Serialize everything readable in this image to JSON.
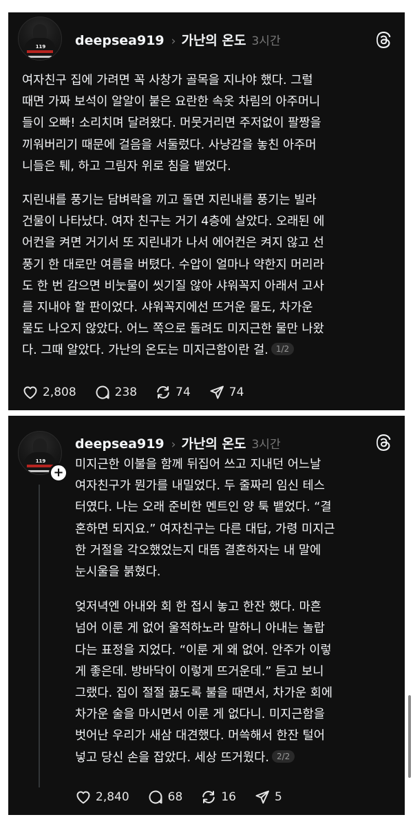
{
  "posts": [
    {
      "username": "deepsea919",
      "topic": "가난의 온도",
      "time": "3시간",
      "paragraphs": [
        [
          "여자친구 집에 가려면 꼭 사창가 골목을 지나야 했다. 그럴",
          "때면 가짜 보석이 알알이 붙은 요란한 속옷 차림의 아주머니",
          "들이 오빠! 소리치며 달려왔다. 머뭇거리면 주저없이 팔짱을",
          "끼워버리기 때문에 걸음을 서둘렀다. 사냥감을 놓친 아주머",
          "니들은 퉤, 하고 그림자 위로 침을 뱉었다."
        ],
        [
          "지린내를 풍기는 담벼락을 끼고 돌면 지린내를 풍기는 빌라",
          "건물이 나타났다. 여자 친구는 거기 4층에 살았다. 오래된 에",
          "어컨을 켜면 거기서 또 지린내가 나서 에어컨은 켜지 않고 선",
          "풍기 한 대로만 여름을 버텼다. 수압이 얼마나 약한지 머리라",
          "도 한 번 감으면 비눗물이 씻기질 않아 샤워꼭지 아래서 고사",
          "를 지내야 할 판이었다. 샤워꼭지에선 뜨거운 물도, 차가운",
          "물도 나오지 않았다. 어느 쪽으로 돌려도 미지근한 물만 나왔",
          "다. 그때 알았다. 가난의 온도는 미지근함이란 걸."
        ]
      ],
      "page": "1/2",
      "likes": "2,808",
      "comments": "238",
      "reposts": "74",
      "shares": "74"
    },
    {
      "username": "deepsea919",
      "topic": "가난의 온도",
      "time": "3시간",
      "paragraphs": [
        [
          "미지근한 이불을 함께 뒤집어 쓰고 지내던 어느날",
          "여자친구가 뭔가를 내밀었다. 두 줄짜리 임신 테스",
          "터였다. 나는 오래 준비한 멘트인 양 툭 뱉었다. “결",
          "혼하면 되지요.” 여자친구는 다른 대답, 가령 미지근",
          "한 거절을 각오했었는지 대뜸 결혼하자는 내 말에",
          "눈시울을 붉혔다."
        ],
        [
          "엊저녁엔 아내와 회 한 접시 놓고 한잔 했다. 마흔",
          "넘어 이룬 게 없어 울적하노라 말하니 아내는 놀랍",
          "다는 표정을 지었다. “이룬 게 왜 없어. 안주가 이렇",
          "게 좋은데. 방바닥이 이렇게 뜨거운데.” 듣고 보니",
          "그랬다. 집이 절절 끓도록 불을 때면서, 차가운 회에",
          "차가운 술을 마시면서 이룬 게 없다니. 미지근함을",
          "벗어난 우리가 새삼 대견했다. 머쓱해서 한잔 털어",
          "넣고 당신 손을 잡았다. 세상 뜨거웠다."
        ]
      ],
      "page": "2/2",
      "likes": "2,840",
      "comments": "68",
      "reposts": "16",
      "shares": "5"
    }
  ],
  "colors": {
    "card_bg": "#101010",
    "text": "#f3f5f7",
    "muted": "#777777",
    "page_bg": "#ffffff"
  },
  "icons": [
    "threads-logo-icon",
    "heart-icon",
    "comment-icon",
    "repost-icon",
    "share-icon",
    "plus-icon"
  ]
}
